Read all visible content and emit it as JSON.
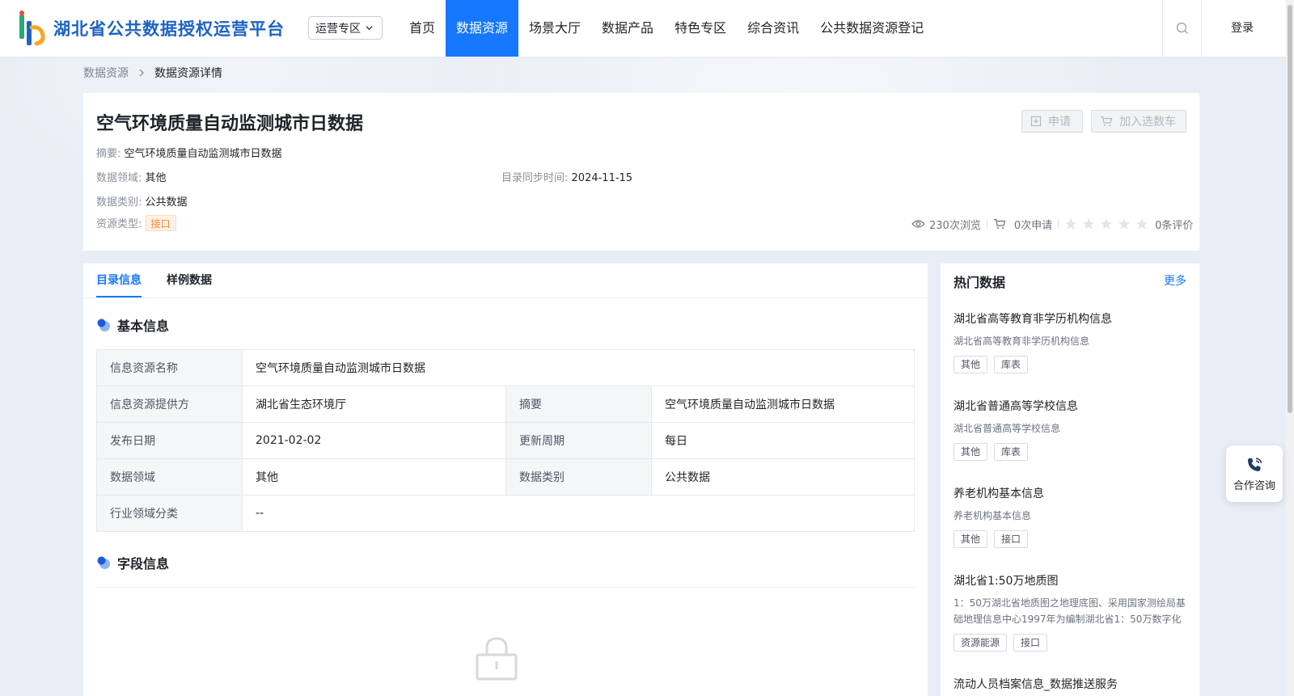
{
  "header": {
    "logo_text": "湖北省公共数据授权运营平台",
    "zone_select": "运营专区",
    "nav": [
      "首页",
      "数据资源",
      "场景大厅",
      "数据产品",
      "特色专区",
      "综合资讯",
      "公共数据资源登记"
    ],
    "active_nav": "数据资源",
    "login": "登录",
    "brand_color": "#1677ff"
  },
  "breadcrumb": {
    "parent": "数据资源",
    "current": "数据资源详情"
  },
  "resource": {
    "title": "空气环境质量自动监测城市日数据",
    "summary_key": "摘要:",
    "summary": "空气环境质量自动监测城市日数据",
    "domain_key": "数据领域:",
    "domain": "其他",
    "sync_key": "目录同步时间:",
    "sync_time": "2024-11-15",
    "category_key": "数据类别:",
    "category": "公共数据",
    "type_key": "资源类型:",
    "type": "接口",
    "apply_label": "申请",
    "cart_label": "加入选数车",
    "views": "230次浏览",
    "applies": "0次申请",
    "rating_stars": 0,
    "reviews": "0条评价"
  },
  "tabs": [
    "目录信息",
    "样例数据"
  ],
  "sections": {
    "basic": "基本信息",
    "fields": "字段信息"
  },
  "basic_info": {
    "name_key": "信息资源名称",
    "name_val": "空气环境质量自动监测城市日数据",
    "provider_key": "信息资源提供方",
    "provider_val": "湖北省生态环境厅",
    "abstract_key": "摘要",
    "abstract_val": "空气环境质量自动监测城市日数据",
    "publish_key": "发布日期",
    "publish_val": "2021-02-02",
    "cycle_key": "更新周期",
    "cycle_val": "每日",
    "domain_key": "数据领域",
    "domain_val": "其他",
    "category_key": "数据类别",
    "category_val": "公共数据",
    "industry_key": "行业领域分类",
    "industry_val": "--"
  },
  "hot": {
    "title": "热门数据",
    "more": "更多",
    "items": [
      {
        "name": "湖北省高等教育非学历机构信息",
        "desc": "湖北省高等教育非学历机构信息",
        "tags": [
          "其他",
          "库表"
        ]
      },
      {
        "name": "湖北省普通高等学校信息",
        "desc": "湖北省普通高等学校信息",
        "tags": [
          "其他",
          "库表"
        ]
      },
      {
        "name": "养老机构基本信息",
        "desc": "养老机构基本信息",
        "tags": [
          "其他",
          "接口"
        ]
      },
      {
        "name": "湖北省1:50万地质图",
        "desc": "1：50万湖北省地质图之地理底图、采用国家测绘局基础地理信息中心1997年为编制湖北省1：50万数字化地",
        "tags": [
          "资源能源",
          "接口"
        ]
      },
      {
        "name": "流动人员档案信息_数据推送服务",
        "desc": "",
        "tags": []
      }
    ]
  },
  "consult": "合作咨询"
}
